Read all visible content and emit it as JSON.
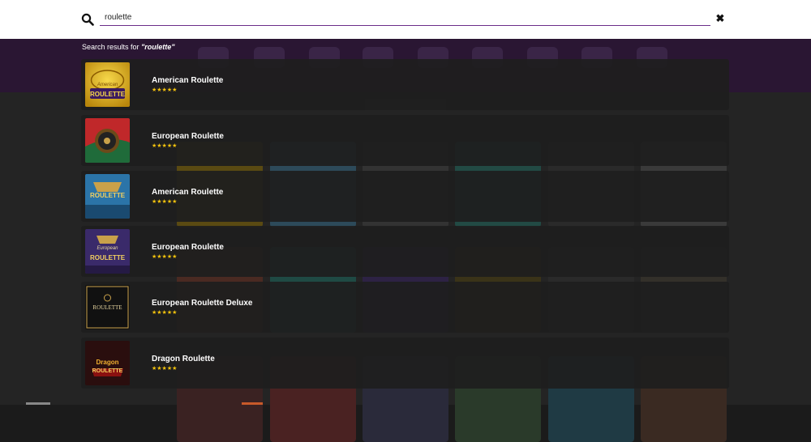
{
  "search": {
    "value": "roulette",
    "results_prefix": "Search results for ",
    "query_label": "\"roulette\""
  },
  "icons": {
    "search": "search-icon",
    "clear": "close-icon",
    "rating": "star-icon"
  },
  "colors": {
    "accent": "#6b2d8a",
    "stars": "#f2c20d",
    "overlay_row": "#1e1e1e"
  },
  "results": [
    {
      "title": "American Roulette",
      "rating": 5,
      "stars": "★★★★★",
      "thumb_text": "ROULETTE",
      "thumb_sub": "American"
    },
    {
      "title": "European Roulette",
      "rating": 5,
      "stars": "★★★★★",
      "thumb_text": "",
      "thumb_sub": ""
    },
    {
      "title": "American Roulette",
      "rating": 5,
      "stars": "★★★★★",
      "thumb_text": "ROULETTE",
      "thumb_sub": ""
    },
    {
      "title": "European Roulette",
      "rating": 5,
      "stars": "★★★★★",
      "thumb_text": "ROULETTE",
      "thumb_sub": "European"
    },
    {
      "title": "European Roulette Deluxe",
      "rating": 5,
      "stars": "★★★★★",
      "thumb_text": "ROULETTE",
      "thumb_sub": ""
    },
    {
      "title": "Dragon Roulette",
      "rating": 5,
      "stars": "★★★★★",
      "thumb_text": "ROULETTE",
      "thumb_sub": "Dragon"
    }
  ]
}
